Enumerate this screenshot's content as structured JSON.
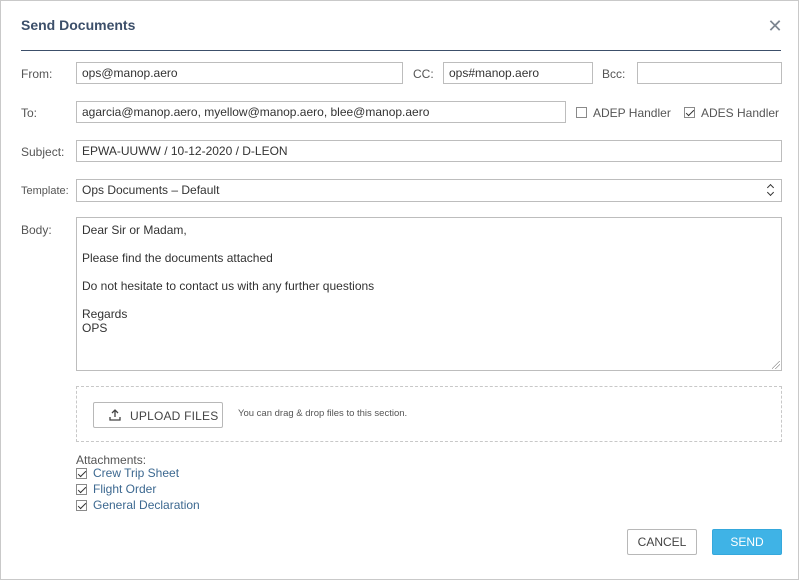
{
  "dialog": {
    "title": "Send Documents",
    "close_icon": "close-icon"
  },
  "form": {
    "from_label": "From:",
    "from_value": "ops@manop.aero",
    "cc_label": "CC:",
    "cc_value": "ops#manop.aero",
    "bcc_label": "Bcc:",
    "bcc_value": "",
    "to_label": "To:",
    "to_value": "agarcia@manop.aero, myellow@manop.aero, blee@manop.aero",
    "adep_handler": {
      "label": "ADEP Handler",
      "checked": false
    },
    "ades_handler": {
      "label": "ADES Handler",
      "checked": true
    },
    "subject_label": "Subject:",
    "subject_value": "EPWA-UUWW / 10-12-2020 / D-LEON",
    "template_label": "Template:",
    "template_value": "Ops Documents – Default",
    "body_label": "Body:",
    "body_lines": [
      "Dear Sir or Madam,",
      "",
      "Please find the documents attached",
      "",
      "Do not hesitate to contact us with any further questions",
      "",
      "Regards",
      "OPS"
    ]
  },
  "upload": {
    "button_label": "UPLOAD FILES",
    "icon": "upload-icon",
    "hint": "You can drag & drop files to this section."
  },
  "attachments": {
    "title": "Attachments:",
    "items": [
      {
        "label": "Crew Trip Sheet",
        "checked": true
      },
      {
        "label": "Flight Order",
        "checked": true
      },
      {
        "label": "General Declaration",
        "checked": true
      }
    ]
  },
  "actions": {
    "cancel_label": "CANCEL",
    "send_label": "SEND"
  },
  "colors": {
    "title": "#3c4f6a",
    "link": "#3c6890",
    "send_button": "#3fb3e6"
  }
}
